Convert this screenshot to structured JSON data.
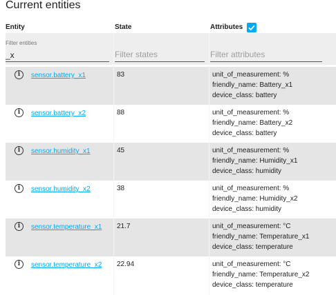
{
  "page": {
    "title": "Current entities"
  },
  "headers": {
    "entity": "Entity",
    "state": "State",
    "attributes": "Attributes",
    "attributes_checked": true
  },
  "filters": {
    "entity_label": "Filter entities",
    "entity_value": "_x",
    "state_placeholder": "Filter states",
    "attributes_placeholder": "Filter attributes"
  },
  "rows": [
    {
      "entity": "sensor.battery_x1",
      "state": "83",
      "attrs": [
        "unit_of_measurement: %",
        "friendly_name: Battery_x1",
        "device_class: battery"
      ]
    },
    {
      "entity": "sensor.battery_x2",
      "state": "88",
      "attrs": [
        "unit_of_measurement: %",
        "friendly_name: Battery_x2",
        "device_class: battery"
      ]
    },
    {
      "entity": "sensor.humidity_x1",
      "state": "45",
      "attrs": [
        "unit_of_measurement: %",
        "friendly_name: Humidity_x1",
        "device_class: humidity"
      ]
    },
    {
      "entity": "sensor.humidity_x2",
      "state": "38",
      "attrs": [
        "unit_of_measurement: %",
        "friendly_name: Humidity_x2",
        "device_class: humidity"
      ]
    },
    {
      "entity": "sensor.temperature_x1",
      "state": "21.7",
      "attrs": [
        "unit_of_measurement: °C",
        "friendly_name: Temperature_x1",
        "device_class: temperature"
      ]
    },
    {
      "entity": "sensor.temperature_x2",
      "state": "22.94",
      "attrs": [
        "unit_of_measurement: °C",
        "friendly_name: Temperature_x2",
        "device_class: temperature"
      ]
    }
  ]
}
